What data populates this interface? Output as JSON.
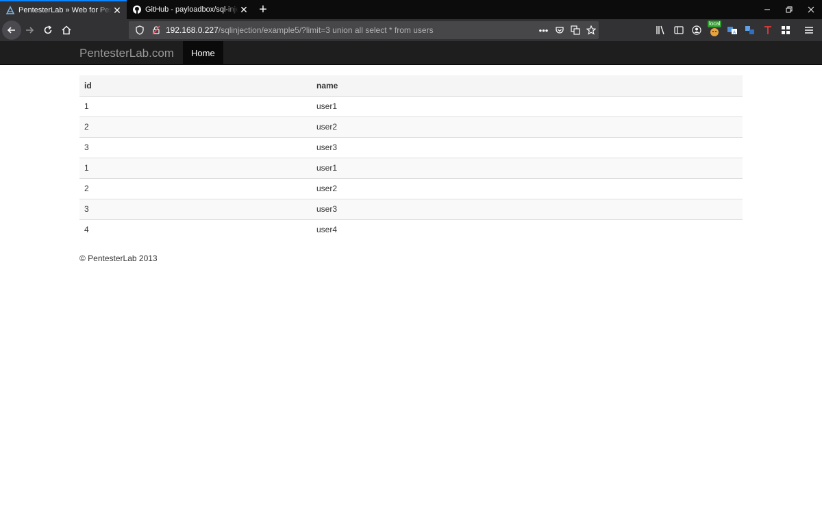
{
  "browser": {
    "tabs": [
      {
        "title": "PentesterLab » Web for Pentest",
        "favicon": "pentesterlab-icon",
        "active": true
      },
      {
        "title": "GitHub - payloadbox/sql-injection",
        "favicon": "github-icon",
        "active": false
      }
    ],
    "new_tab": "+",
    "url_host": "192.168.0.227",
    "url_path": "/sqlinjection/example5/?limit=3 union all select * from users",
    "extension_badge": "local",
    "accent": "#0a84ff"
  },
  "site": {
    "brand": "PentesterLab.com",
    "nav_home": "Home"
  },
  "table": {
    "headers": [
      "id",
      "name"
    ],
    "rows": [
      [
        "1",
        "user1"
      ],
      [
        "2",
        "user2"
      ],
      [
        "3",
        "user3"
      ],
      [
        "1",
        "user1"
      ],
      [
        "2",
        "user2"
      ],
      [
        "3",
        "user3"
      ],
      [
        "4",
        "user4"
      ]
    ]
  },
  "footer": "© PentesterLab 2013"
}
